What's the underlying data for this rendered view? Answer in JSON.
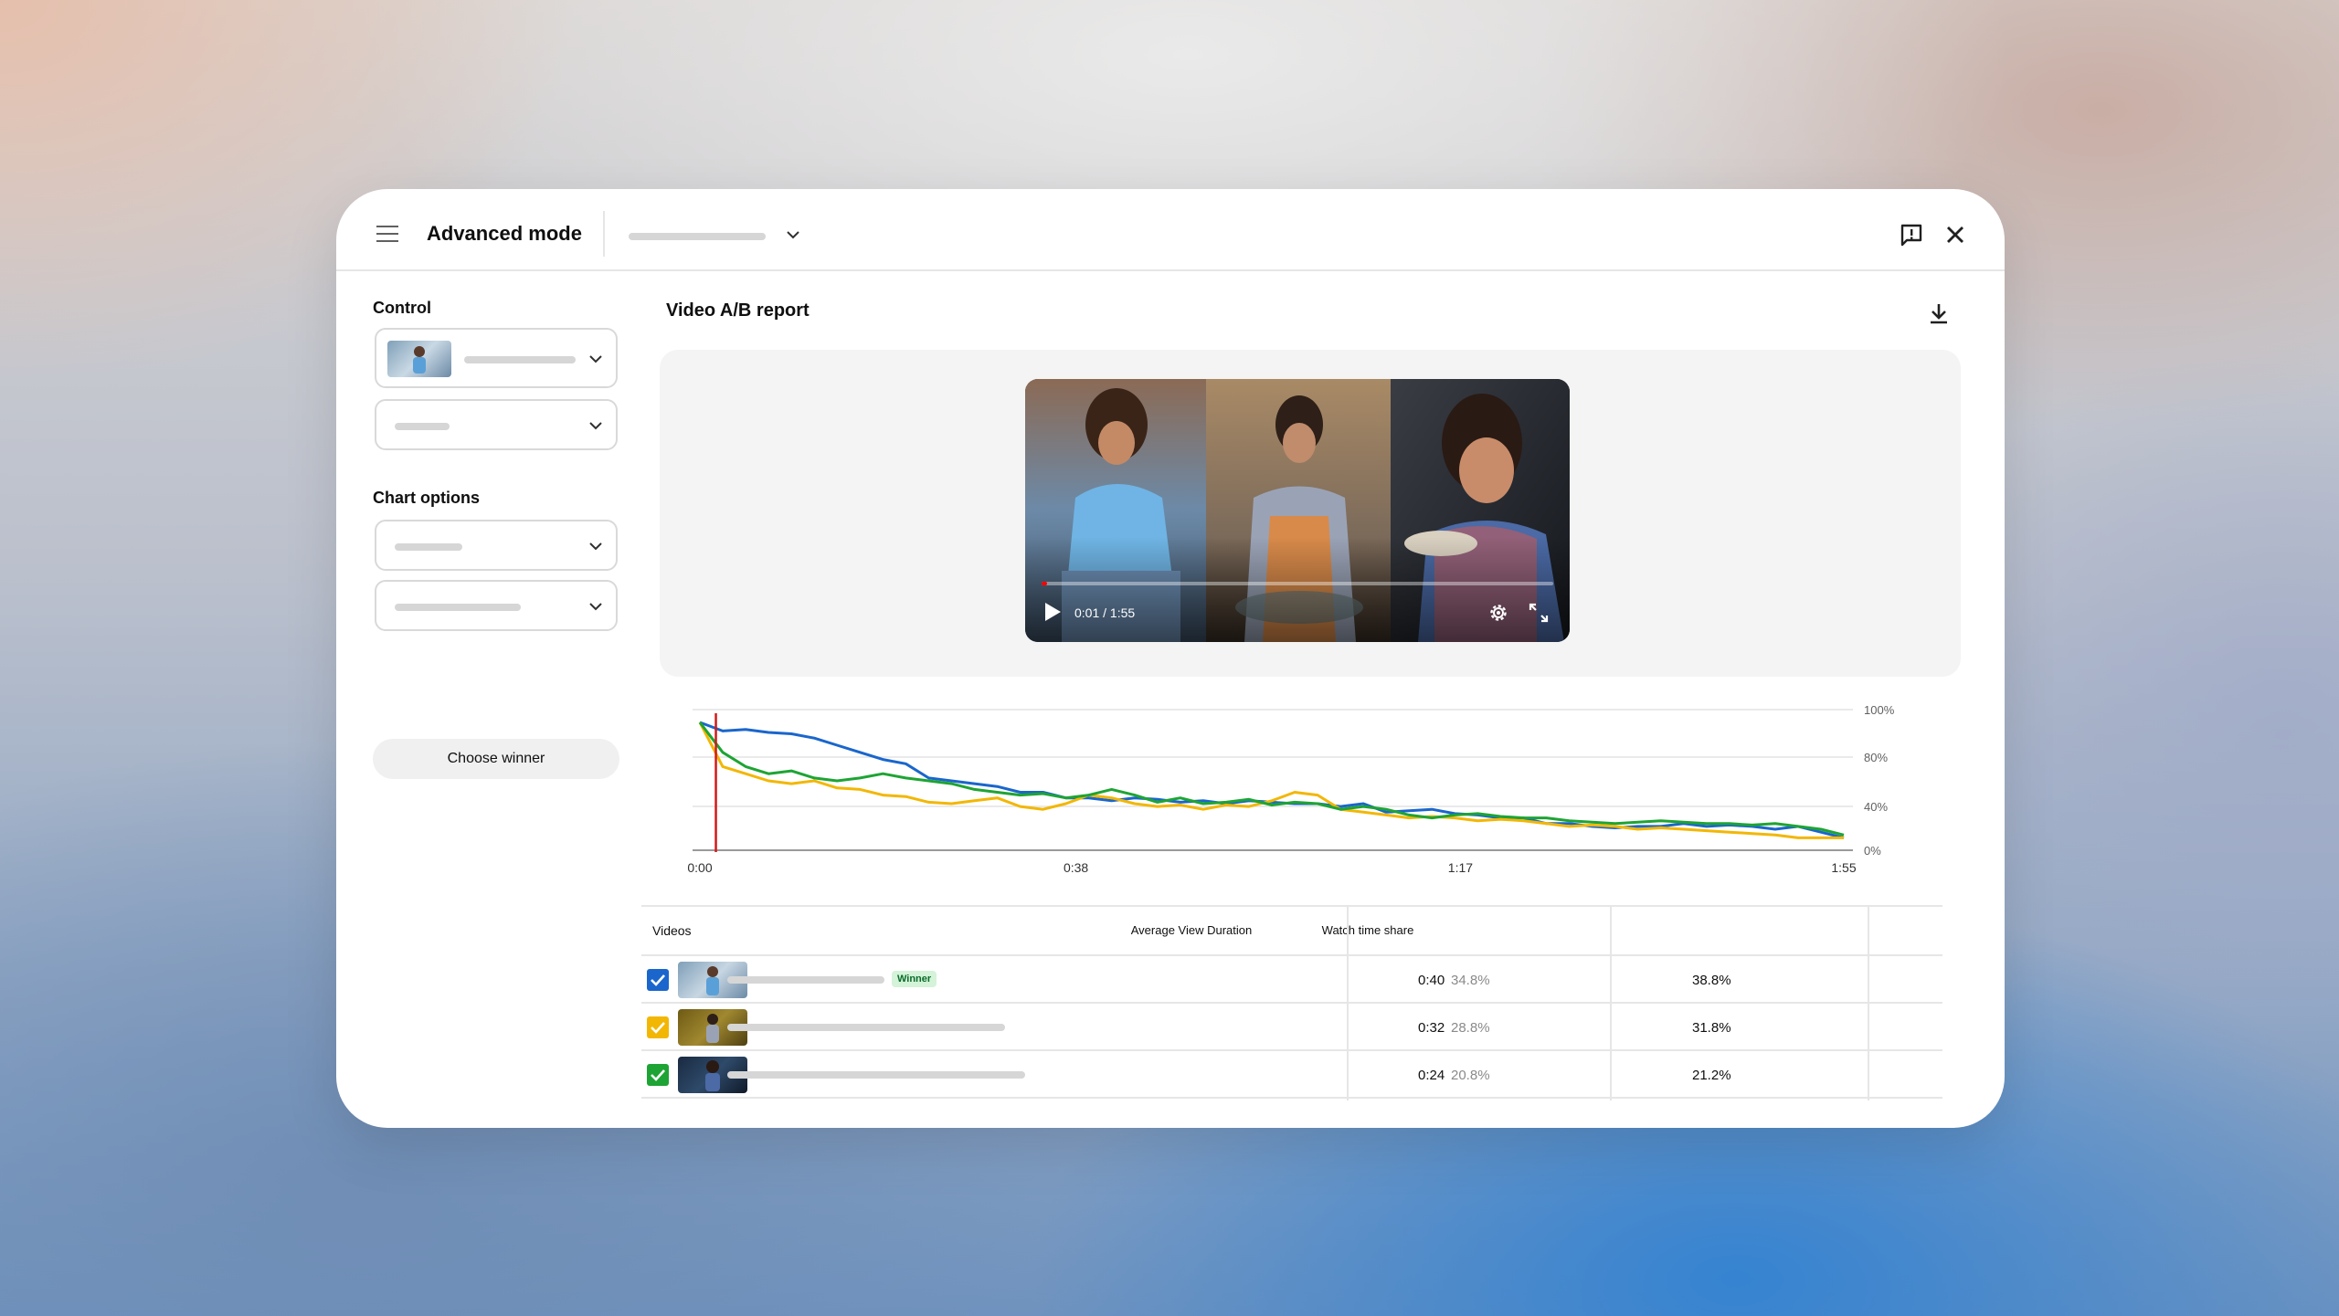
{
  "app": {
    "title": "Advanced mode"
  },
  "sidebar": {
    "control_label": "Control",
    "chart_options_label": "Chart options",
    "choose_winner_label": "Choose winner"
  },
  "report": {
    "title": "Video A/B report",
    "player": {
      "time": "0:01 / 1:55",
      "progress": 0.01
    }
  },
  "chart_data": {
    "type": "line",
    "x_ticks": [
      "0:00",
      "0:38",
      "1:17",
      "1:55"
    ],
    "y_ticks": [
      "100%",
      "80%",
      "40%",
      "0%"
    ],
    "series": [
      {
        "color": "#1a66cc",
        "values": [
          100,
          85,
          86,
          84,
          83,
          80,
          75,
          70,
          65,
          62,
          52,
          50,
          48,
          46,
          42,
          42,
          38,
          38,
          36,
          38,
          37,
          35,
          36,
          34,
          36,
          35,
          34,
          34,
          32,
          34,
          28,
          29,
          30,
          27,
          26,
          24,
          24,
          20,
          20,
          18,
          17,
          18,
          18,
          20,
          18,
          19,
          18,
          16,
          18,
          14,
          10
        ]
      },
      {
        "color": "#f2b705",
        "values": [
          100,
          60,
          55,
          50,
          48,
          50,
          45,
          44,
          40,
          39,
          35,
          34,
          36,
          38,
          32,
          30,
          34,
          40,
          38,
          34,
          32,
          33,
          30,
          33,
          32,
          36,
          42,
          40,
          30,
          28,
          26,
          24,
          25,
          24,
          22,
          23,
          22,
          20,
          18,
          19,
          18,
          16,
          17,
          16,
          15,
          14,
          13,
          12,
          10,
          10,
          10
        ]
      },
      {
        "color": "#1ea434",
        "values": [
          100,
          70,
          60,
          55,
          57,
          52,
          50,
          52,
          55,
          52,
          50,
          48,
          44,
          42,
          40,
          41,
          38,
          40,
          44,
          40,
          35,
          38,
          34,
          35,
          37,
          33,
          35,
          34,
          30,
          32,
          30,
          26,
          24,
          26,
          27,
          25,
          24,
          24,
          22,
          21,
          20,
          21,
          22,
          21,
          20,
          20,
          19,
          20,
          18,
          16,
          12
        ]
      }
    ],
    "ylim": [
      0,
      100
    ],
    "marker_x": 0.014
  },
  "table": {
    "headers": [
      "Videos",
      "Average View Duration",
      "Watch time share"
    ],
    "rows": [
      {
        "check_color": "#1a66cc",
        "winner": "Winner",
        "avd": "0:40",
        "avd_pct": "34.8%",
        "share": "38.8%"
      },
      {
        "check_color": "#f2b705",
        "winner": "",
        "avd": "0:32",
        "avd_pct": "28.8%",
        "share": "31.8%"
      },
      {
        "check_color": "#1ea434",
        "winner": "",
        "avd": "0:24",
        "avd_pct": "20.8%",
        "share": "21.2%"
      }
    ]
  },
  "icons": {
    "menu": "hamburger-icon",
    "dropdown": "chevron-down-icon",
    "feedback": "feedback-icon",
    "close": "close-icon",
    "download": "download-icon",
    "play": "play-icon",
    "settings": "settings-gear-icon",
    "fullscreen": "fullscreen-icon"
  }
}
